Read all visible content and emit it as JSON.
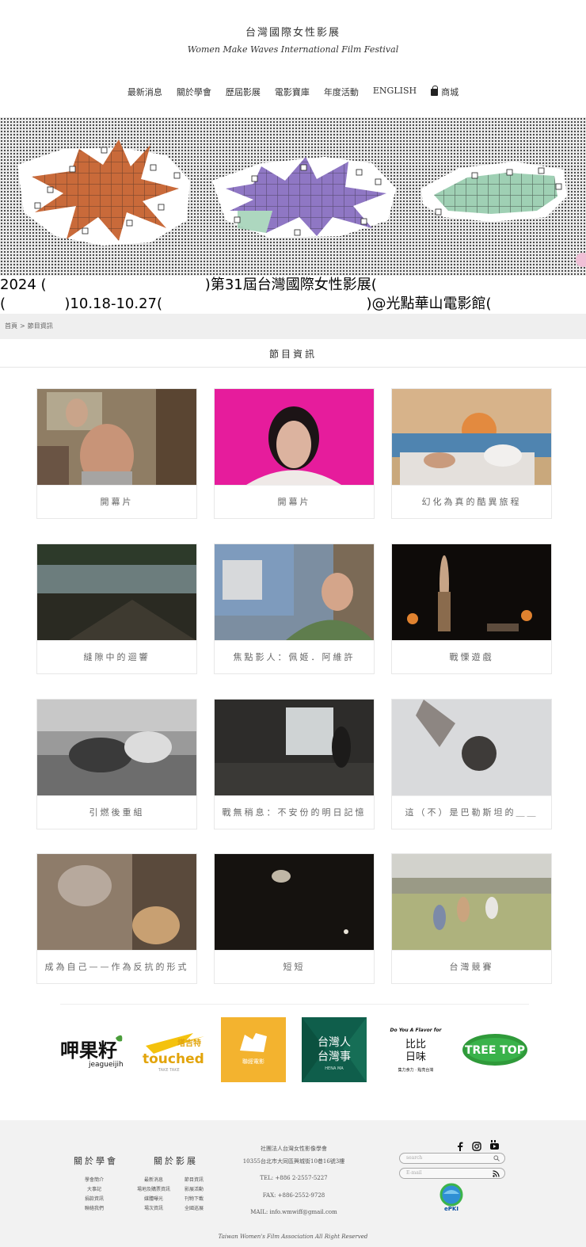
{
  "header": {
    "title": "台灣國際女性影展",
    "subtitle": "Women Make Waves International Film Festival"
  },
  "nav": {
    "items": [
      "最新消息",
      "關於學會",
      "歷屆影展",
      "電影寶庫",
      "年度活動",
      "ENGLISH"
    ],
    "shop": "商城"
  },
  "banner": {
    "line1": "2024 (                                   )第31屆台灣國際女性影展(",
    "line2": "(             )10.18-10.27(                                             )@光點華山電影館(",
    "colors": {
      "orange": "#c96a3a",
      "purple": "#8f77c4",
      "green": "#9fd0b4",
      "pink": "#f0bfd6"
    }
  },
  "breadcrumb": {
    "home": "首頁",
    "separator": ">",
    "current": "節目資訊"
  },
  "section": {
    "title": "節目資訊"
  },
  "programs": [
    {
      "label": "開幕片"
    },
    {
      "label": "開幕片"
    },
    {
      "label": "幻化為真的酷異旅程"
    },
    {
      "label": "縫隙中的迴響"
    },
    {
      "label": "焦點影人：佩姬．阿維許"
    },
    {
      "label": "戰慄遊戲"
    },
    {
      "label": "引燃後重組"
    },
    {
      "label": "戰無稍息：不安份的明日記憶"
    },
    {
      "label": "這（不）是巴勒斯坦的＿＿"
    },
    {
      "label": "成為自己——作為反抗的形式"
    },
    {
      "label": "短短"
    },
    {
      "label": "台灣競賽"
    }
  ],
  "sponsors": {
    "jeague": {
      "main": "呷果籽",
      "sub": "jeagueijih"
    },
    "touched": {
      "main": "touched",
      "zh": "塔吉特",
      "sub": "TAKE TAKE"
    },
    "spot": {
      "label": "聯經電影"
    },
    "tw": {
      "line1": "台灣人",
      "line2": "台灣事",
      "sub": "HENA MA"
    },
    "flavor": {
      "top": "Do You A Flavor for",
      "mid": "比比",
      "mid2": "日味",
      "bottom": "集力食力 · 點亮台灣"
    },
    "treetop": {
      "label": "TREE TOP"
    }
  },
  "footer": {
    "about": {
      "title": "關於學會",
      "links": [
        "學會簡介",
        "大事記",
        "捐款資訊",
        "聯絡我們"
      ]
    },
    "festival": {
      "title": "關於影展",
      "col1": [
        "最新消息",
        "場地及購票資訊",
        "媒體曝光",
        "場次資訊"
      ],
      "col2": [
        "節目資訊",
        "影展活動",
        "刊物下載",
        "全國巡展"
      ]
    },
    "org": "社團法人台灣女性影像學會",
    "address": "10355台北市大同區興城街10巷16號3樓",
    "tel": "TEL: +886 2-2557-5227",
    "fax": "FAX: +886-2552-9728",
    "mail": "MAIL: info.wmwiff@gmail.com",
    "search_placeholder": "search",
    "email_placeholder": "E-mail",
    "epki": "ePKI",
    "copyright": "Taiwan Women's Film Association All Right Reserved"
  }
}
